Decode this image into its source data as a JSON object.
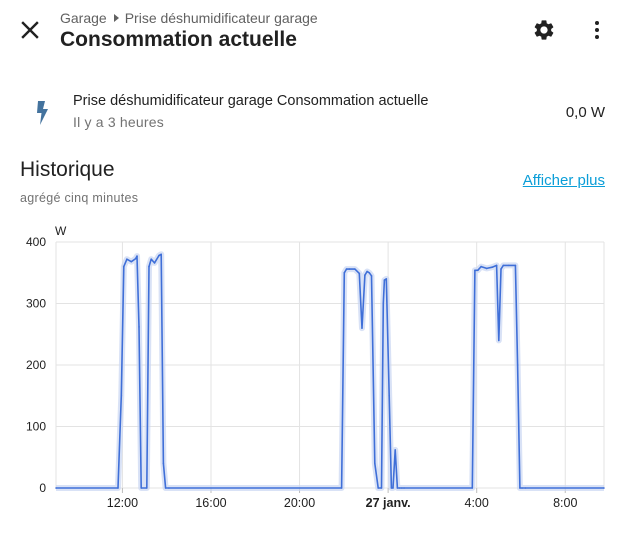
{
  "header": {
    "breadcrumb": [
      "Garage",
      "Prise déshumidificateur garage"
    ],
    "title": "Consommation actuelle"
  },
  "entity": {
    "name": "Prise déshumidificateur garage Consommation actuelle",
    "last_changed": "Il y a 3 heures",
    "state": "0,0 W",
    "icon": "flash-icon"
  },
  "history": {
    "title": "Historique",
    "subtitle": "agrégé cinq minutes",
    "show_more": "Afficher plus"
  },
  "colors": {
    "series": "#3f6fd8",
    "band": "#c9d6f2",
    "link": "#0a9ed8",
    "grid": "#e3e3e3"
  },
  "chart_data": {
    "type": "line",
    "unit": "W",
    "ylim": [
      0,
      400
    ],
    "yticks": [
      0,
      100,
      200,
      300,
      400
    ],
    "xlim": [
      9,
      33.75
    ],
    "xticks": [
      {
        "v": 12,
        "label": "12:00",
        "bold": false
      },
      {
        "v": 16,
        "label": "16:00",
        "bold": false
      },
      {
        "v": 20,
        "label": "20:00",
        "bold": false
      },
      {
        "v": 24,
        "label": "27 janv.",
        "bold": true
      },
      {
        "v": 28,
        "label": "4:00",
        "bold": false
      },
      {
        "v": 32,
        "label": "8:00",
        "bold": false
      }
    ],
    "grid": true,
    "series": [
      {
        "x": [
          9,
          11.8,
          11.95,
          12.06,
          12.2,
          12.4,
          12.6,
          12.66,
          12.75,
          12.85,
          13.1,
          13.2,
          13.3,
          13.45,
          13.65,
          13.75,
          13.85,
          13.95,
          14.1,
          21.9,
          22.02,
          22.12,
          22.25,
          22.5,
          22.7,
          22.82,
          22.95,
          23.05,
          23.15,
          23.25,
          23.4,
          23.55,
          23.7,
          23.78,
          23.83,
          23.92,
          24.05,
          24.15,
          24.22,
          24.32,
          24.42,
          24.52,
          24.62,
          24.72,
          27.8,
          27.92,
          28.05,
          28.2,
          28.45,
          28.7,
          28.9,
          29.0,
          29.1,
          29.2,
          29.45,
          29.75,
          29.85,
          29.95,
          30.05,
          30.2,
          33.75
        ],
        "y": [
          0,
          0,
          150,
          360,
          372,
          368,
          373,
          377,
          262,
          0,
          0,
          360,
          372,
          366,
          378,
          380,
          40,
          0,
          0,
          0,
          350,
          356,
          356,
          356,
          349,
          260,
          346,
          352,
          350,
          345,
          40,
          0,
          0,
          300,
          338,
          340,
          150,
          0,
          0,
          62,
          0,
          0,
          0,
          0,
          0,
          354,
          354,
          360,
          357,
          359,
          362,
          240,
          356,
          362,
          362,
          362,
          200,
          0,
          0,
          0,
          0
        ]
      }
    ]
  }
}
